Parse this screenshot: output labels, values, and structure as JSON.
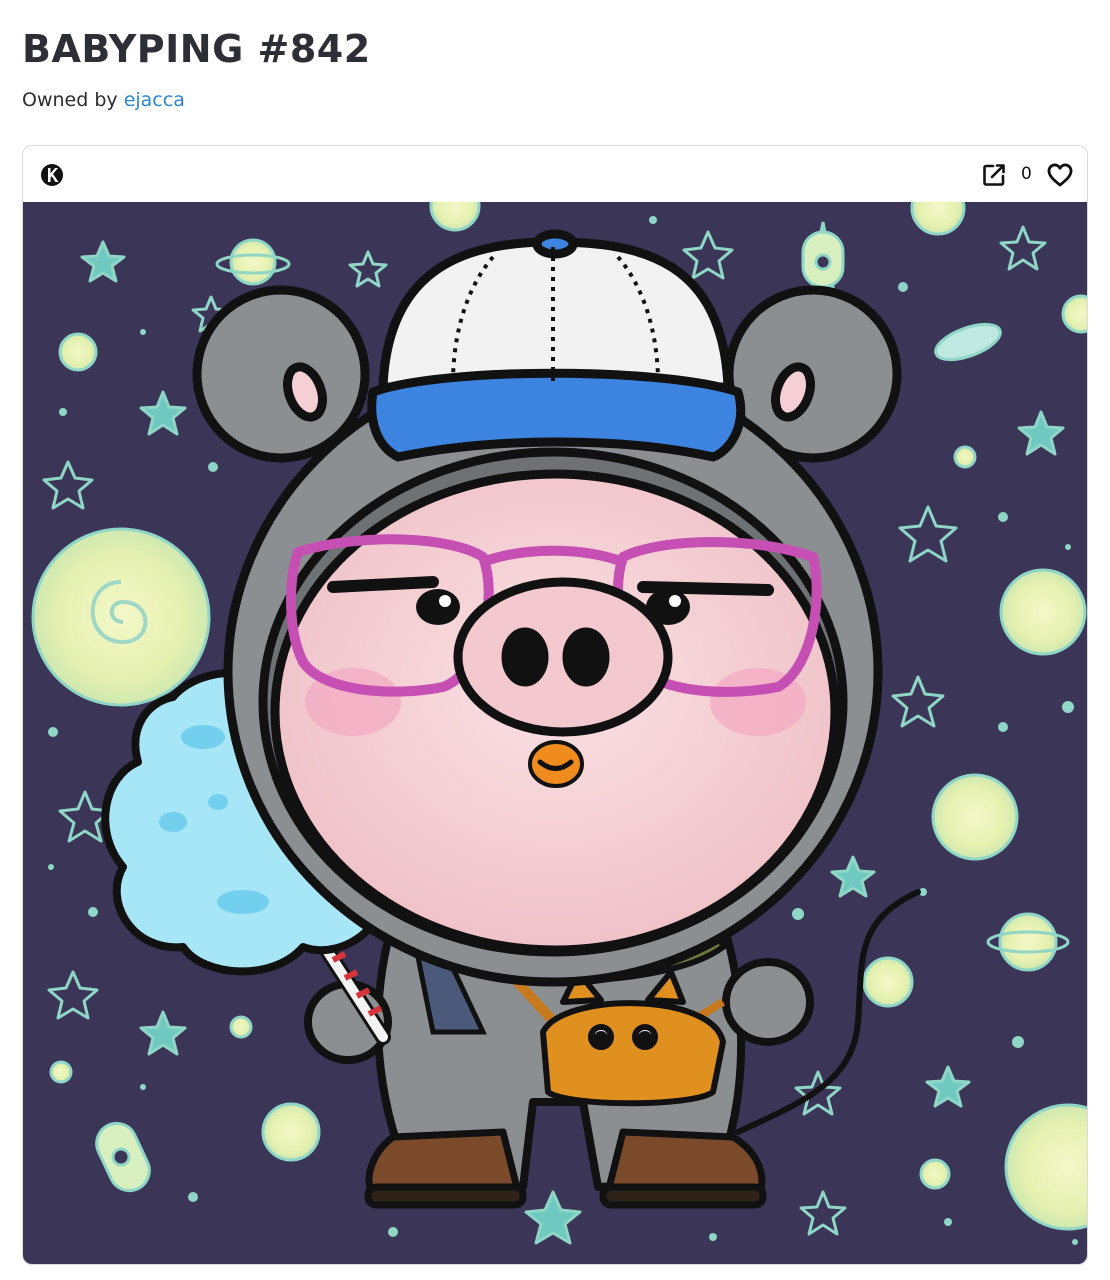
{
  "page": {
    "title": "BABYPING #842",
    "owner_prefix": "Owned by",
    "owner_name": "ejacca"
  },
  "card": {
    "chain_icon": "blockchain-logo-icon",
    "share_icon": "external-link-icon",
    "like_count": "0",
    "like_icon": "heart-outline-icon"
  },
  "artwork": {
    "alt": "Cartoon pig in a grey mouse costume wearing a white and blue baseball cap and pink glasses, holding blue cotton candy, on a dark purple starry background with planets and rockets",
    "colors": {
      "background": "#3b3558",
      "glow": "#e9f3b8",
      "star": "#8fd6c6",
      "costume": "#8c8f92",
      "face": "#f5cfd4",
      "cap_white": "#f2f2f2",
      "cap_blue": "#3c84e0",
      "glasses": "#c64fb4",
      "cotton_candy": "#a6e6f7",
      "bag": "#e0901f",
      "boots": "#7a4a2a"
    }
  }
}
